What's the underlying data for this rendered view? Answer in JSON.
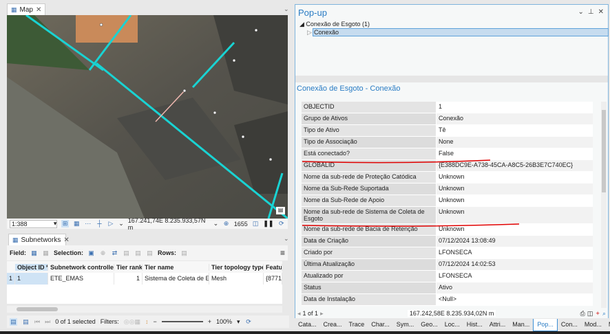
{
  "map": {
    "tab": "Map",
    "scale": "1:388",
    "coords": "167.241,74E 8.235.933,57N m",
    "selected_count": "1655"
  },
  "subnetworks": {
    "tab": "Subnetworks",
    "field_label": "Field:",
    "selection_label": "Selection:",
    "rows_label": "Rows:",
    "columns": [
      "Object ID *",
      "Subnetwork controlle...",
      "Tier rank",
      "Tier name",
      "Tier topology type",
      "Featu"
    ],
    "rows": [
      {
        "n": "1",
        "cells": [
          "1",
          "ETE_EMAS",
          "1",
          "Sistema de Coleta de Es...",
          "Mesh",
          "{8771-"
        ]
      }
    ],
    "status": "0 of 1 selected",
    "filters_label": "Filters:",
    "zoom": "100%"
  },
  "popup": {
    "title": "Pop-up",
    "layer": "Conexão de Esgoto (1)",
    "feature": "Conexão",
    "section_title": "Conexão de Esgoto - Conexão",
    "fields": [
      {
        "k": "OBJECTID",
        "v": "1"
      },
      {
        "k": "Grupo de Ativos",
        "v": "Conexão"
      },
      {
        "k": "Tipo de Ativo",
        "v": "Tê"
      },
      {
        "k": "Tipo de Associação",
        "v": "None"
      },
      {
        "k": "Está conectado?",
        "v": "False"
      },
      {
        "k": "GLOBALID",
        "v": "{E388DC9E-A738-45CA-A8C5-26B3E7C740EC}"
      },
      {
        "k": "Nome da sub-rede de Proteção Catódica",
        "v": "Unknown"
      },
      {
        "k": "Nome da Sub-Rede Suportada",
        "v": "Unknown"
      },
      {
        "k": "Nome da Sub-Rede de Apoio",
        "v": "Unknown"
      },
      {
        "k": "Nome da sub-rede de Sistema de Coleta de Esgoto",
        "v": "Unknown"
      },
      {
        "k": "Nome da sub-rede de Bacia de Retenção",
        "v": "Unknown"
      },
      {
        "k": "Data de Criação",
        "v": "07/12/2024 13:08:49"
      },
      {
        "k": "Criado por",
        "v": "LFONSECA"
      },
      {
        "k": "Última Atualização",
        "v": "07/12/2024 14:02:53"
      },
      {
        "k": "Atualizado por",
        "v": "LFONSECA"
      },
      {
        "k": "Status",
        "v": "Ativo"
      },
      {
        "k": "Data de Instalação",
        "v": "<Null>"
      }
    ],
    "nav": "1 of 1",
    "coords": "167.242,58E 8.235.934,02N m"
  },
  "bottom_tabs": [
    "Cata...",
    "Crea...",
    "Trace",
    "Char...",
    "Sym...",
    "Geo...",
    "Loc...",
    "Hist...",
    "Attri...",
    "Man...",
    "Pop...",
    "Con...",
    "Mod...",
    "Mod..."
  ],
  "colors": {
    "accent": "#2a7cc4",
    "network": "#19d3d3",
    "annotation": "#e00000"
  }
}
